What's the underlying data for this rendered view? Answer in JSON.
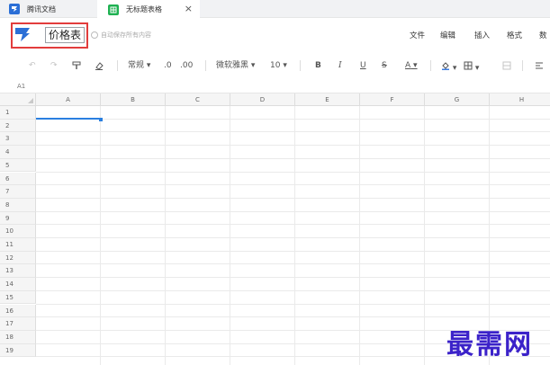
{
  "tabs": [
    {
      "label": "腾讯文档",
      "icon": "tencent-docs-icon"
    },
    {
      "label": "无标题表格",
      "icon": "sheet-icon",
      "close": "×"
    }
  ],
  "header": {
    "title": "价格表",
    "autosave": "自动保存所有内容",
    "menus": [
      "文件",
      "编辑",
      "插入",
      "格式",
      "数"
    ]
  },
  "toolbar": {
    "number_format": "常规",
    "decimal_dec": ".0",
    "decimal_inc": ".00",
    "font": "微软雅黑",
    "font_size": "10",
    "bold": "B",
    "italic": "I",
    "underline": "U",
    "strike": "S",
    "font_color": "A"
  },
  "cell_ref": "A1",
  "columns": [
    "A",
    "B",
    "C",
    "D",
    "E",
    "F",
    "G",
    "H"
  ],
  "rows": [
    "1",
    "2",
    "3",
    "4",
    "5",
    "6",
    "7",
    "8",
    "9",
    "10",
    "11",
    "12",
    "13",
    "14",
    "15",
    "16",
    "17",
    "18",
    "19"
  ],
  "watermark": "最需网",
  "colors": {
    "accent": "#2a7fe0",
    "highlight": "#e23c3c",
    "watermark": "#3b22c9"
  }
}
